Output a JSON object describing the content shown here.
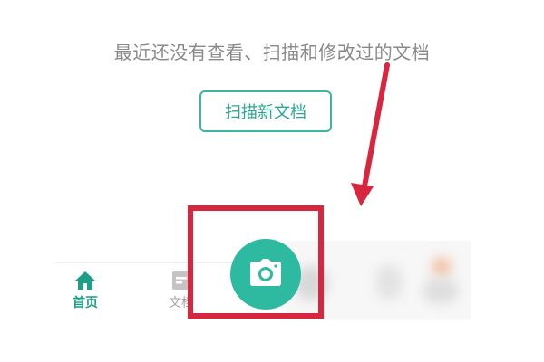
{
  "empty_state": {
    "message": "最近还没有查看、扫描和修改过的文档",
    "scan_button_label": "扫描新文档"
  },
  "tab_bar": {
    "items": [
      {
        "label": "首页",
        "icon": "home-icon",
        "active": true
      },
      {
        "label": "文档",
        "icon": "document-icon",
        "active": false
      }
    ],
    "fab_icon": "camera-icon"
  },
  "colors": {
    "accent": "#2dbaa0",
    "accent_dark": "#1f9e86",
    "annotation_red": "#d7263d",
    "muted_text": "#8a8a8a"
  }
}
